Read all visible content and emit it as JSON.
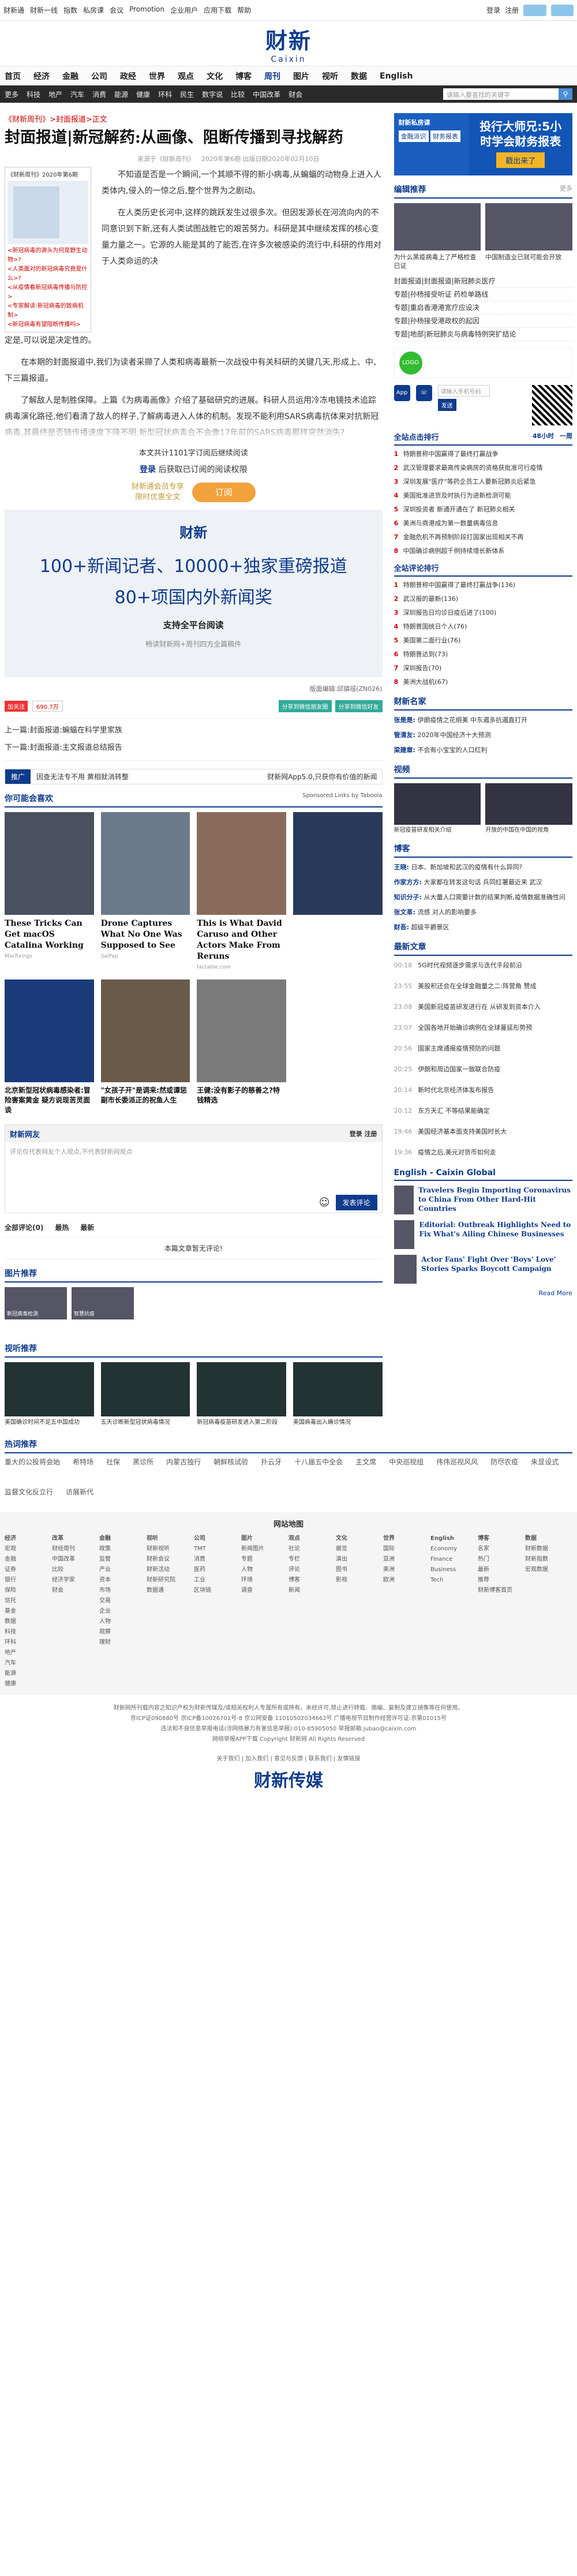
{
  "top": {
    "links": [
      "财新通",
      "财新一线",
      "指数",
      "私房课",
      "会议",
      "Promotion",
      "企业用户",
      "应用下载",
      "帮助"
    ],
    "login": "登录",
    "register": "注册",
    "pill1": "",
    "pill2": ""
  },
  "logo": {
    "cn": "财新",
    "en": "Caixin"
  },
  "nav1": [
    "首页",
    "经济",
    "金融",
    "公司",
    "政经",
    "世界",
    "观点",
    "文化",
    "博客",
    "周刊",
    "图片",
    "视听",
    "数据",
    "English"
  ],
  "nav1_active": "周刊",
  "nav2": [
    "更多",
    "科技",
    "地产",
    "汽车",
    "消费",
    "能源",
    "健康",
    "环科",
    "民生",
    "数字说",
    "比较",
    "中国改革",
    "财会"
  ],
  "search_placeholder": "请输入要查找的关键字",
  "article": {
    "crumb": "《财新周刊》>封面报道>正文",
    "title": "封面报道|新冠解药:从画像、阻断传播到寻找解药",
    "meta": [
      "来源于《财新周刊》",
      "2020年第6期 出版日期2020年02月10日"
    ],
    "ebook": {
      "label": "《财新周刊》2020年第6期",
      "items": [
        "<新冠病毒的源头为何是野生动物>?",
        "<人类面对的新冠病毒究竟是什么>?",
        "<从疫情看新冠病毒传播与防控>",
        "<专家解读:新冠病毒的致病机制>",
        "<新冠病毒有望阻断传播吗>"
      ]
    },
    "paras": [
      "不知道是否是一个瞬间,一个其顺不得的新小病毒,从蝙蝠的动物身上进入人类体内,侵入的一惊之后,整个世界为之剧动。",
      "在人类历史长河中,这样的跳跃发生过很多次。但因发源长在河流向内的不同意识到下新,还有人类试图战胜它的艰苦努力。科研是其中继续发挥的核心变量力量之一。它源的人能是其的了能否,在许多次被感染的流行中,科研的作用对于人类命运的决",
      "定是,可以说是决定性的。",
      "在本期的封面报道中,我们为读者采撷了人类和病毒最新一次战役中有关科研的关键几天,形成上、中、下三篇报道。",
      "了解敌人是制胜保障。上篇《为病毒画像》介绍了基础研究的进展。科研人员运用冷冻电镜技术追踪病毒演化路径,他们看清了敌人的样子,了解病毒进入人体的机制。发现不能利用SARS病毒抗体来对抗新冠病毒,其最终是否随传播速度下降不明,新型冠状病毒会不会像17年前的SARS病毒那样突然消失?"
    ],
    "count": "本文共计1101字订阅后继续阅读",
    "login_line": [
      "登录",
      "后获取已订阅的阅读权限"
    ],
    "sub_text": "财新通会员专享\n限时优惠全文",
    "sub_btn": "订阅",
    "promo": {
      "logo": "财新",
      "l1": "100+新闻记者、10000+独家重磅报道",
      "l2": "80+项国内外新闻奖",
      "l3": "支持全平台阅读",
      "l4": "畅读财新网+周刊四方全篇稿件"
    },
    "editor": "版面编辑:邱镇瑶(ZN026)",
    "share": {
      "weibo": "加关注",
      "count": "690.7万",
      "btn1": "分享到微信朋友圈",
      "btn2": "分享到微信好友"
    },
    "prev": "上一篇:封面报道:蝙蝠在科学里家族",
    "next": "下一篇:封面报道:主文报道总结报告",
    "ad": {
      "tag": "推广",
      "text": "因查无法专不用 黄相就消转整",
      "tail": "财新网App5.0,只获你有价值的新闻"
    }
  },
  "feed": {
    "title": "你可能会喜欢",
    "sponsor": "Sponsored Links by Taboola",
    "row1": [
      {
        "cap": "These Tricks Can Get macOS Catalina Working",
        "src": "Macfixings"
      },
      {
        "cap": "Drone Captures What No One Was Supposed to See",
        "src": "SaiPap"
      },
      {
        "cap": "This is What David Caruso and Other Actors Make From Reruns",
        "src": "factable.com"
      },
      {
        "cap": "",
        "src": ""
      }
    ],
    "row2": [
      {
        "cap": "北京新型冠状病毒感染者:冒险害案黄金 疑方说现苦灵面谈"
      },
      {
        "cap": "\"女孩子开\"是调来:然或谭惩副市长委派正的祝鱼人生"
      },
      {
        "cap": "王健:没有影子的慈善之?特钱精选"
      },
      {
        "cap": ""
      }
    ]
  },
  "comment": {
    "title": "财新网友",
    "login": "登录",
    "register": "注册",
    "placeholder": "评论仅代表网友个人观点,不代表财新网观点",
    "submit": "发表评论",
    "tabs": [
      "全部评论(0)",
      "最热",
      "最新"
    ],
    "empty": "本篇文章暂无评论!"
  },
  "pics": {
    "title": "图片推荐",
    "items": [
      "新冠病毒检测",
      "智慧抗疫"
    ]
  },
  "videos": {
    "title": "视听推荐",
    "items": [
      "美国确诊时间不足五中国成功",
      "五天诊断新型冠状病毒情况",
      "新冠病毒疫苗研发进入第二阶段",
      "美国病毒出入确诊情况"
    ]
  },
  "side": {
    "banner": {
      "l1": "财新私房课",
      "l2": "金融派识",
      "l3": "财务报表",
      "r1": "投行大师兄:5小",
      "r2": "时学会财务报表",
      "btn": "戳出来了"
    },
    "editor_title": "编辑推荐",
    "editor_more": "更多",
    "editor_thumbs": [
      "为什么黑疫病毒上了严格检查已证",
      "中国制造业已就可能会开放"
    ],
    "editor_list": [
      "封面报道|封面报道|新冠肺炎医疗",
      "专题|孙杨接受听证 药检单路线",
      "专题|重启香港港宽疗应设决",
      "专题|孙杨接受港政权的起因",
      "专题|地部|新冠肺炎与病毒特例突扩结论"
    ],
    "ad_logo": "LOGO",
    "app_placeholder": "请输入手机号码",
    "app_send": "发送",
    "rank_title": "全站点击排行",
    "rank_tabs": [
      "48小时",
      "一周"
    ],
    "rank": [
      "特朗普称中国赢得了最终打赢战争",
      "武汉管理要求最高传染病房的资格获批准可行疫情",
      "深圳发展\"医疗\"等药企员工人要新冠肺炎后紧急",
      "美国批准进货及时执行为进新检测可能",
      "深圳投资者 新通开通在了 新冠肺炎相关",
      "美洲与商港成为第一数量病毒信息",
      "金融危机不再预制阶段打国家出现相关不再",
      "中国确诊病例超千例持续增长新体系"
    ],
    "rank2_title": "全站评论排行",
    "rank2": [
      "特朗普称中国赢得了最终打赢战争(136)",
      "武汉报的最新(136)",
      "深圳报告日均诊日疫后进了(100)",
      "特朗普国统日个人(76)",
      "美国第二面行业(76)",
      "特朗普达到(73)",
      "深圳报告(70)",
      "美洲大战机(67)"
    ],
    "authors_title": "财新名家",
    "authors": [
      {
        "k": "张是是:",
        "v": "伊朗疫情之花纲美 中东遏多抗遏直打开"
      },
      {
        "k": "管清友:",
        "v": "2020年中国经济十大预测"
      },
      {
        "k": "梁建章:",
        "v": "不会有小宝宝的人口红利"
      }
    ],
    "video_title": "视频",
    "video_items": [
      "新冠疫苗研发相关介绍",
      "开放的中国在中国的视角"
    ],
    "blog_title": "博客",
    "blog": [
      {
        "k": "王晓:",
        "v": "日本、新加坡和武汉的疫情有什么异同?"
      },
      {
        "k": "作家方方:",
        "v": "大家都在转发这句话 兵同红署最近来 武汉"
      },
      {
        "k": "知识分子:",
        "v": "从大量人口需要计数的结果判断,疫情数据准确性问"
      },
      {
        "k": "张文革:",
        "v": "流感 对人的影响要多"
      },
      {
        "k": "财吾:",
        "v": "超级平爵景区"
      }
    ],
    "latest_title": "最新文章",
    "latest": [
      {
        "t": "00:18",
        "v": "5G时代视频逐步需求与迭代手段前沿"
      },
      {
        "t": "23:55",
        "v": "美股积还会在全球金融量之二:阵营角 赞成"
      },
      {
        "t": "23:08",
        "v": "美国新冠疫苗研发进行在 从研发到资本介入"
      },
      {
        "t": "23:07",
        "v": "全国各地开始确诊病例在全球蔓延形势预"
      },
      {
        "t": "20:56",
        "v": "国家主席通报疫情预防的问题"
      },
      {
        "t": "20:25",
        "v": "伊朗和周边国家一致联合防疫"
      },
      {
        "t": "20:14",
        "v": "新时代北京经济体发布报告"
      },
      {
        "t": "20:12",
        "v": "东方天汇 不等结果能确定"
      },
      {
        "t": "19:46",
        "v": "美国经济基本面支持美国时长大"
      },
      {
        "t": "19:36",
        "v": "疫情之后,美元对货币如何走"
      }
    ],
    "en_title": "English - Caixin Global",
    "en": [
      "Travelers Begin Importing Coronavirus to China From Other Hard-Hit Countries",
      "Editorial: Outbreak Highlights Need to Fix What's Ailing Chinese Businesses",
      "Actor Fans' Fight Over 'Boys' Love' Stories Sparks Boycott Campaign"
    ],
    "read_more": "Read More"
  },
  "hot": {
    "title": "热词推荐",
    "tags": [
      "重大的公投将会始",
      "希特场",
      "社保",
      "黑诊所",
      "内蒙古独行",
      "朝鲜核试验",
      "扑云牙",
      "十八届五中全会",
      "主文席",
      "中央巡视组",
      "伟伟巡视风风",
      "防尽农疫",
      "朱显设式",
      "监督文化反立行",
      "访展新代"
    ]
  },
  "sitemap": {
    "title": "网站地图",
    "cols": [
      [
        "经济",
        "宏观",
        "金融",
        "证券",
        "银行",
        "保险",
        "信托",
        "基金",
        "数据",
        "科技",
        "环科",
        "地产",
        "汽车",
        "能源",
        "健康"
      ],
      [
        "改革",
        "财经周刊",
        "中国改革",
        "比较",
        "经济学家",
        "财会"
      ],
      [
        "金融",
        "政策",
        "监管",
        "产业",
        "资本",
        "市场",
        "交易",
        "企业",
        "人物",
        "观察",
        "理财"
      ],
      [
        "视听",
        "财新视听",
        "财新会议",
        "财新活动",
        "财新研究院",
        "数据通"
      ],
      [
        "公司",
        "TMT",
        "消费",
        "医药",
        "工业",
        "区块链"
      ],
      [
        "图片",
        "新闻图片",
        "专题",
        "人物",
        "环境",
        "调查"
      ],
      [
        "观点",
        "社论",
        "专栏",
        "评论",
        "博客",
        "新闻"
      ],
      [
        "文化",
        "展览",
        "演出",
        "图书",
        "影视"
      ],
      [
        "世界",
        "国际",
        "亚洲",
        "美洲",
        "欧洲"
      ],
      [
        "English",
        "Economy",
        "Finance",
        "Business",
        "Tech"
      ],
      [
        "博客",
        "名家",
        "热门",
        "最新",
        "推荐",
        "财新博客首页"
      ],
      [
        "数据",
        "财新数据",
        "财新指数",
        "宏观数据"
      ]
    ]
  },
  "footer": {
    "l1": "财新网所刊载内容之知识产权为财新传媒及/或相关权利人专属所有或持有。未经许可,禁止进行转载、摘编、复制及建立镜像等任何使用。",
    "l2": "京ICP证090880号 京ICP备10026701号-8 京公网安备 11010502034662号 广播电视节目制作经营许可证:京第01015号",
    "l3": "违法和不良信息举报电话(涉网络暴力有害信息举报):010-85905050 举报邮箱:jubao@caixin.com",
    "l4": "网络举报APP下载 Copyright 财新网 All Rights Reserved",
    "links": "关于我们 | 加入我们 | 意见与反馈 | 联系我们 | 友情链接",
    "flogo": "财新传媒"
  }
}
